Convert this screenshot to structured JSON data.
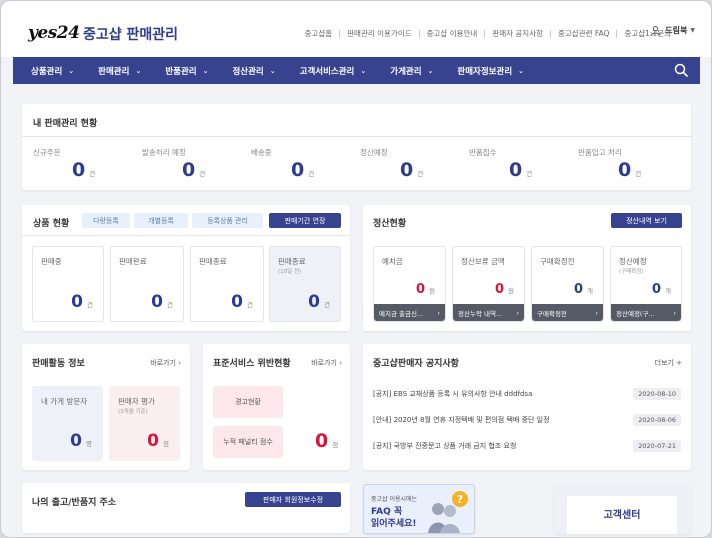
{
  "header": {
    "logo": "yes24",
    "title": "중고샵 판매관리",
    "utility_links": [
      "중고샵홈",
      "판매관리 이용가이드",
      "중고샵 이용안내",
      "판매자 공지사항",
      "중고샵관련 FAQ",
      "중고샵1:1문의"
    ],
    "user_name": "드림북"
  },
  "nav": {
    "items": [
      "상품관리",
      "판매관리",
      "반품관리",
      "정산관리",
      "고객서비스관리",
      "가게관리",
      "판매자정보관리"
    ]
  },
  "sales_status": {
    "title": "내 판매관리 현황",
    "unit": "건",
    "stats": [
      {
        "label": "신규주문",
        "value": "0"
      },
      {
        "label": "발송처리 예정",
        "value": "0"
      },
      {
        "label": "배송중",
        "value": "0"
      },
      {
        "label": "정산예정",
        "value": "0"
      },
      {
        "label": "반품접수",
        "value": "0"
      },
      {
        "label": "반품입고 처리",
        "value": "0"
      }
    ]
  },
  "product_status": {
    "title": "상품 현황",
    "tabs": [
      "다량등록",
      "개별등록",
      "등록상품 관리"
    ],
    "extend_button": "판매기간 연장",
    "unit": "건",
    "cards": [
      {
        "label": "판매중",
        "sub": "",
        "value": "0"
      },
      {
        "label": "판매완료",
        "sub": "",
        "value": "0"
      },
      {
        "label": "판매종료",
        "sub": "",
        "value": "0"
      },
      {
        "label": "판매종료",
        "sub": "(10일 전)",
        "value": "0"
      }
    ]
  },
  "settlement": {
    "title": "정산현황",
    "view_button": "정산내역 보기",
    "cards": [
      {
        "label": "예치금",
        "sub": "",
        "value": "0",
        "unit": "원",
        "bar": "예치금 출금신..."
      },
      {
        "label": "정산보류 금액",
        "sub": "",
        "value": "0",
        "unit": "원",
        "bar": "정산누락 내역..."
      },
      {
        "label": "구매확정전",
        "sub": "",
        "value": "0",
        "unit": "개",
        "bar": "구매확정전"
      },
      {
        "label": "정산예정",
        "sub": "(구매확정)",
        "value": "0",
        "unit": "개",
        "bar": "정산예정(구..."
      }
    ]
  },
  "activity": {
    "title": "판매활동 정보",
    "shortcut": "바로가기",
    "visitors_label": "내 가게 방문자",
    "visitors_value": "0",
    "visitors_unit": "명",
    "rating_label": "판매자 평가",
    "rating_sub": "(3개월 기준)",
    "rating_value": "0",
    "rating_unit": "점"
  },
  "violation": {
    "title": "표준서비스 위반현황",
    "shortcut": "바로가기",
    "warning_label": "경고현황",
    "penalty_label": "누적 페널티 점수",
    "penalty_value": "0",
    "penalty_unit": "점"
  },
  "notices": {
    "title": "중고샵판매자 공지사항",
    "more": "더보기",
    "items": [
      {
        "text": "[공지] EBS 교재상품 등록 시 유의사항 안내 dddfdsa",
        "date": "2020-08-10"
      },
      {
        "text": "[안내] 2020년 8월 연휴 지정택배 및 편의점 택배 중단 일정",
        "date": "2020-08-06"
      },
      {
        "text": "[공지] 국방부 진중문고 상품 거래 금지 협조 요청",
        "date": "2020-07-21"
      }
    ]
  },
  "address": {
    "title": "나의 출고/반품지 주소",
    "edit_button": "판매자 회원정보수정"
  },
  "faq_banner": {
    "line1": "중고샵 이용시에는",
    "line2": "FAQ 꼭",
    "line3": "읽어주세요!"
  },
  "customer_center": {
    "title": "고객센터"
  }
}
